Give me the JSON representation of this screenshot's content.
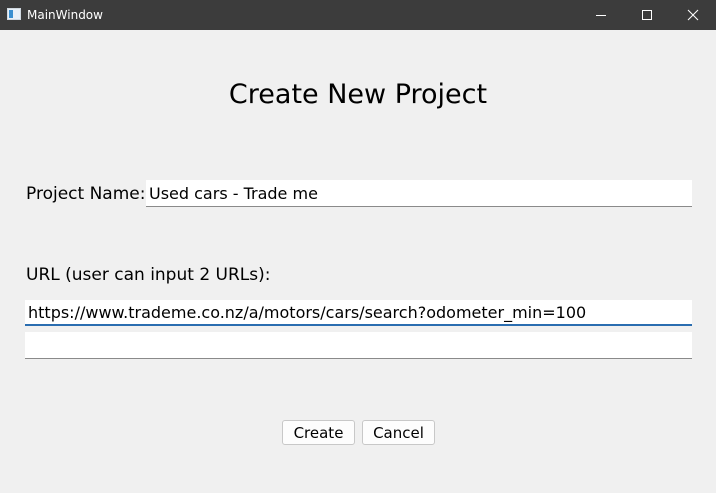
{
  "window": {
    "title": "MainWindow",
    "controls": [
      "minimize-icon",
      "maximize-icon",
      "close-icon"
    ]
  },
  "form": {
    "heading": "Create New Project",
    "project_name_label": "Project Name:",
    "project_name_value": "Used cars - Trade me",
    "url_label": "URL (user can input 2 URLs):",
    "url1_value": "https://www.trademe.co.nz/a/motors/cars/search?odometer_min=100",
    "url2_value": ""
  },
  "buttons": {
    "create_label": "Create",
    "cancel_label": "Cancel"
  },
  "colors": {
    "titlebar": "#3c3c3c",
    "background": "#f0f0f0",
    "focus_accent": "#2a6db0"
  }
}
